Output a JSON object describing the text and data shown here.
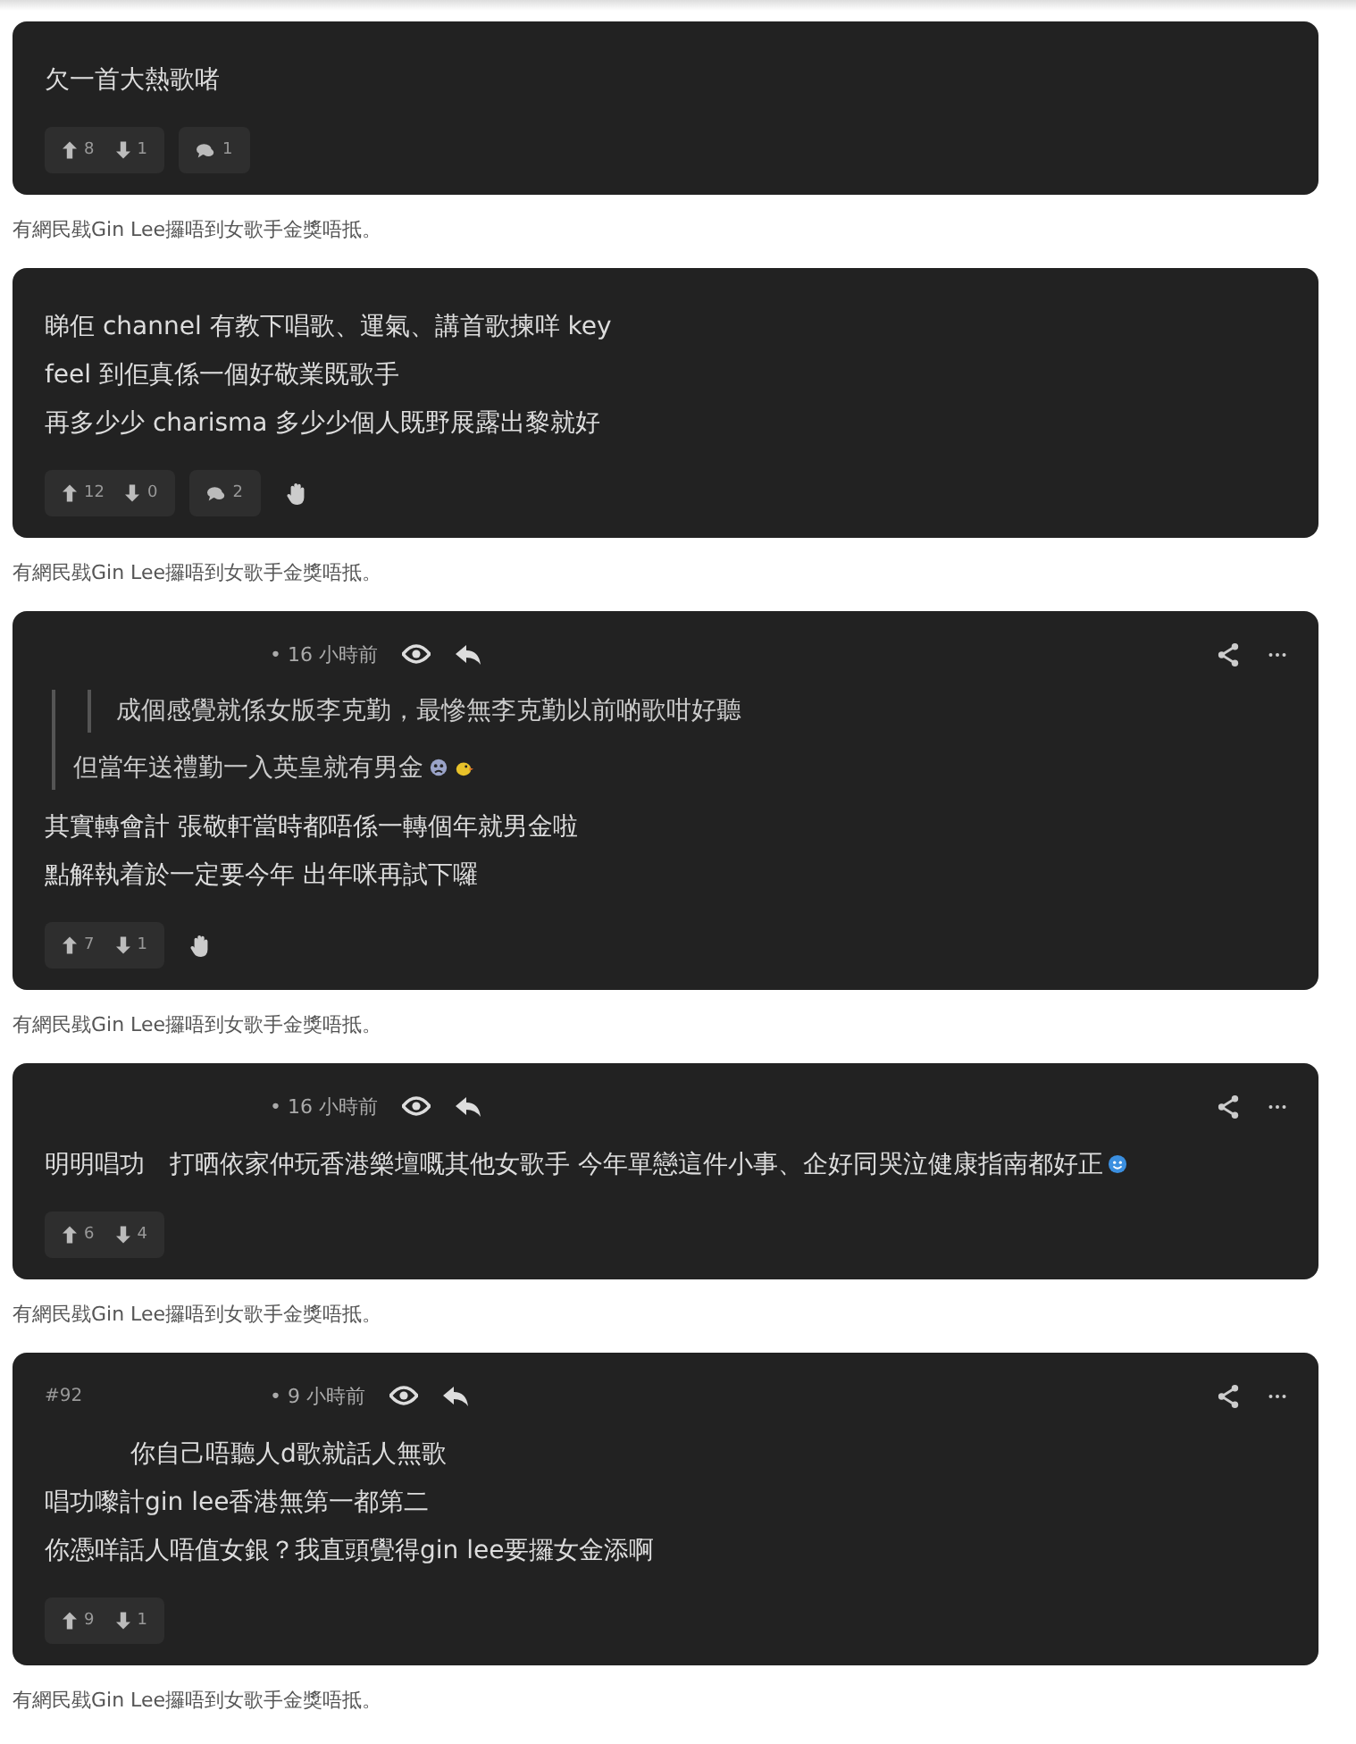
{
  "posts": [
    {
      "lines": [
        {
          "text": "欠一首大熱歌啫"
        }
      ],
      "upvotes": "8",
      "downvotes": "1",
      "comments": "1",
      "hand": false,
      "caption": "有網民戥Gin Lee攞唔到女歌手金獎唔抵。"
    },
    {
      "lines": [
        {
          "text": "睇佢 channel 有教下唱歌、運氣、講首歌揀咩 key"
        },
        {
          "text": "feel 到佢真係一個好敬業既歌手"
        },
        {
          "text": "再多少少 charisma 多少少個人既野展露出黎就好"
        }
      ],
      "upvotes": "12",
      "downvotes": "0",
      "comments": "2",
      "hand": true,
      "caption": "有網民戥Gin Lee攞唔到女歌手金獎唔抵。"
    },
    {
      "header": {
        "time": "• 16 小時前"
      },
      "quote": {
        "nested": "成個感覺就係女版李克勤，最慘無李克勤以前啲歌咁好聽",
        "text": "但當年送禮勤一入英皇就有男金",
        "emojis": [
          {
            "kind": "frown"
          },
          {
            "kind": "chick"
          }
        ]
      },
      "lines": [
        {
          "text": "其實轉會計 張敬軒當時都唔係一轉個年就男金啦"
        },
        {
          "text": "點解執着於一定要今年 出年咪再試下囉"
        }
      ],
      "upvotes": "7",
      "downvotes": "1",
      "hand": true,
      "caption": "有網民戥Gin Lee攞唔到女歌手金獎唔抵。"
    },
    {
      "header": {
        "time": "• 16 小時前"
      },
      "lines": [
        {
          "text": "明明唱功　打晒依家仲玩香港樂壇嘅其他女歌手 今年單戀這件小事、企好同哭泣健康指南都好正",
          "emojis": [
            {
              "kind": "smile"
            }
          ]
        }
      ],
      "upvotes": "6",
      "downvotes": "4",
      "hand": false,
      "caption": "有網民戥Gin Lee攞唔到女歌手金獎唔抵。"
    },
    {
      "header": {
        "number": "#92",
        "time": "• 9 小時前"
      },
      "lines": [
        {
          "text": "你自己唔聽人d歌就話人無歌",
          "indented": true
        },
        {
          "text": "唱功嚟計gin lee香港無第一都第二",
          "indented": false
        },
        {
          "text": "你憑咩話人唔值女銀？我直頭覺得gin lee要攞女金添啊",
          "indented": false
        }
      ],
      "upvotes": "9",
      "downvotes": "1",
      "hand": false,
      "caption": "有網民戥Gin Lee攞唔到女歌手金獎唔抵。"
    }
  ]
}
